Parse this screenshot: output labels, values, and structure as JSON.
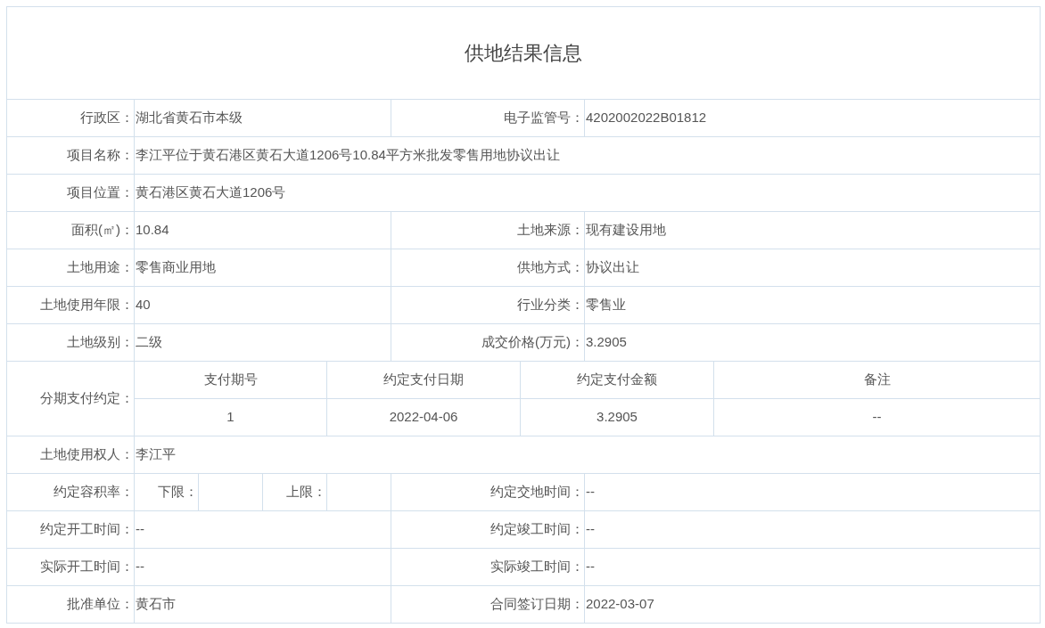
{
  "title": "供地结果信息",
  "rows": [
    {
      "kind": "pair",
      "left": {
        "label": "行政区：",
        "value": "湖北省黄石市本级"
      },
      "right": {
        "label": "电子监管号：",
        "value": "4202002022B01812"
      }
    },
    {
      "kind": "single",
      "left": {
        "label": "项目名称：",
        "value": "李江平位于黄石港区黄石大道1206号10.84平方米批发零售用地协议出让"
      }
    },
    {
      "kind": "single",
      "left": {
        "label": "项目位置：",
        "value": "黄石港区黄石大道1206号"
      }
    },
    {
      "kind": "pair",
      "left": {
        "label": "面积(㎡)：",
        "value": "10.84"
      },
      "right": {
        "label": "土地来源：",
        "value": "现有建设用地"
      }
    },
    {
      "kind": "pair",
      "left": {
        "label": "土地用途：",
        "value": "零售商业用地"
      },
      "right": {
        "label": "供地方式：",
        "value": "协议出让"
      }
    },
    {
      "kind": "pair",
      "left": {
        "label": "土地使用年限：",
        "value": "40"
      },
      "right": {
        "label": "行业分类：",
        "value": "零售业"
      }
    },
    {
      "kind": "pair",
      "left": {
        "label": "土地级别：",
        "value": "二级"
      },
      "right": {
        "label": "成交价格(万元)：",
        "value": "3.2905"
      }
    },
    {
      "kind": "payments",
      "label": "分期支付约定：",
      "columns": [
        "支付期号",
        "约定支付日期",
        "约定支付金额",
        "备注"
      ],
      "rows": [
        [
          "1",
          "2022-04-06",
          "3.2905",
          "--"
        ]
      ]
    },
    {
      "kind": "single",
      "left": {
        "label": "土地使用权人：",
        "value": "李江平"
      }
    },
    {
      "kind": "ratio",
      "label": "约定容积率：",
      "lower_label": "下限：",
      "upper_label": "上限：",
      "right": {
        "label": "约定交地时间：",
        "value": "--"
      }
    },
    {
      "kind": "pair",
      "left": {
        "label": "约定开工时间：",
        "value": "--"
      },
      "right": {
        "label": "约定竣工时间：",
        "value": "--"
      }
    },
    {
      "kind": "pair",
      "left": {
        "label": "实际开工时间：",
        "value": "--"
      },
      "right": {
        "label": "实际竣工时间：",
        "value": "--"
      }
    },
    {
      "kind": "pair",
      "left": {
        "label": "批准单位：",
        "value": "黄石市"
      },
      "right": {
        "label": "合同签订日期：",
        "value": "2022-03-07"
      }
    }
  ]
}
